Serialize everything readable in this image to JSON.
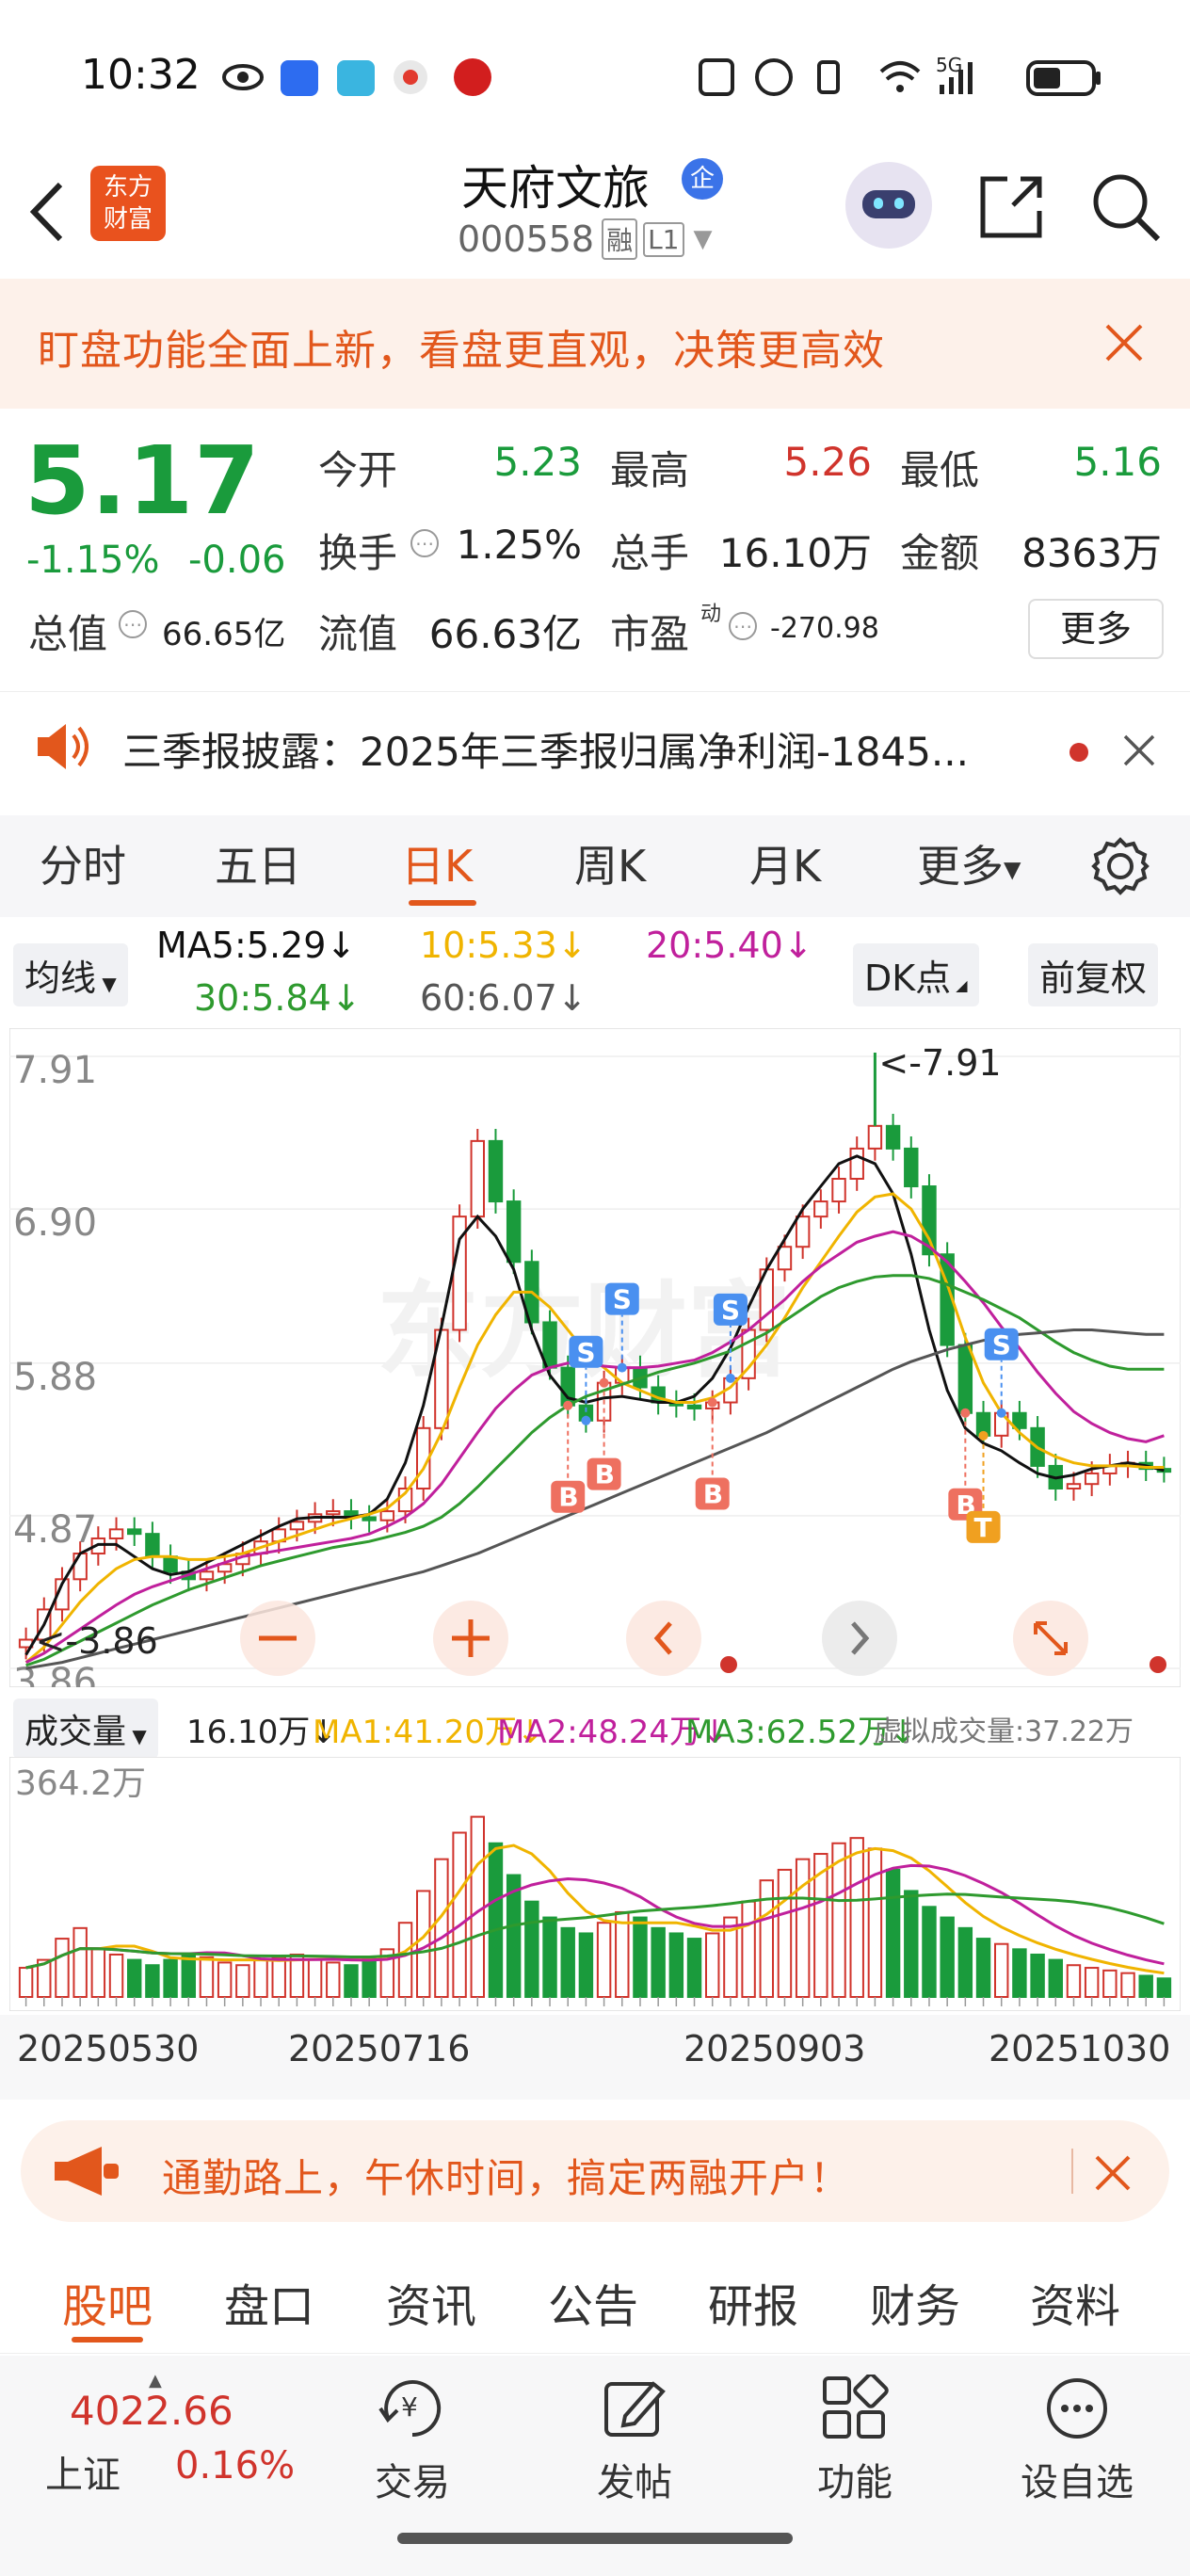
{
  "status_bar": {
    "time": "10:32",
    "network": "5G"
  },
  "header": {
    "back_label": "<",
    "logo_line1": "东方",
    "logo_line2": "财富",
    "stock_name": "天府文旅",
    "enterprise_badge": "企",
    "stock_code": "000558",
    "margin_badge": "融",
    "level_badge": "L1"
  },
  "promo": {
    "text": "盯盘功能全面上新，看盘更直观，决策更高效"
  },
  "quote": {
    "price": "5.17",
    "change_pct": "-1.15%",
    "change_abs": "-0.06",
    "open_label": "今开",
    "open": "5.23",
    "high_label": "最高",
    "high": "5.26",
    "low_label": "最低",
    "low": "5.16",
    "turnover_label": "换手",
    "turnover": "1.25%",
    "volume_label": "总手",
    "volume": "16.10万",
    "amount_label": "金额",
    "amount": "8363万",
    "mktcap_label": "总值",
    "mktcap": "66.65亿",
    "float_label": "流值",
    "float_cap": "66.63亿",
    "pe_label": "市盈",
    "pe_sup": "动",
    "pe": "-270.98",
    "more_button": "更多"
  },
  "ticker": {
    "text": "三季报披露：2025年三季报归属净利润-1845..."
  },
  "period_tabs": [
    "分时",
    "五日",
    "日K",
    "周K",
    "月K",
    "更多"
  ],
  "active_tab": "日K",
  "indicators": {
    "ma_select": "均线",
    "ma5": "MA5:5.29",
    "ma10": "10:5.33",
    "ma20": "20:5.40",
    "ma30": "30:5.84",
    "ma60": "60:6.07",
    "dk_button": "DK点",
    "adjust_button": "前复权"
  },
  "colors": {
    "up": "#d0342c",
    "down": "#1a9b3c",
    "ma5": "#111111",
    "ma10": "#f0b400",
    "ma20": "#c0209c",
    "ma30": "#2e9a2e",
    "ma60": "#555555",
    "accent": "#e2571c"
  },
  "chart_data": {
    "type": "candlestick",
    "y_ticks": [
      "7.91",
      "6.90",
      "5.88",
      "4.87",
      "3.86"
    ],
    "ylim": [
      3.86,
      7.91
    ],
    "max_label": "<-7.91",
    "min_label": "<-3.86",
    "close_series": [
      4.05,
      4.25,
      4.45,
      4.62,
      4.72,
      4.78,
      4.75,
      4.6,
      4.5,
      4.45,
      4.5,
      4.55,
      4.62,
      4.7,
      4.78,
      4.83,
      4.88,
      4.9,
      4.86,
      4.84,
      4.9,
      5.05,
      5.45,
      6.1,
      6.85,
      7.35,
      6.95,
      6.55,
      6.15,
      5.85,
      5.6,
      5.5,
      5.75,
      5.85,
      5.72,
      5.62,
      5.6,
      5.58,
      5.62,
      5.78,
      6.1,
      6.5,
      6.65,
      6.85,
      6.95,
      7.1,
      7.3,
      7.45,
      7.3,
      7.05,
      6.6,
      6.0,
      5.55,
      5.4,
      5.55,
      5.45,
      5.2,
      5.05,
      5.08,
      5.15,
      5.2,
      5.22,
      5.18,
      5.17
    ],
    "ma_series": [
      {
        "name": "MA5",
        "values": [
          3.95,
          4.15,
          4.42,
          4.62,
          4.68,
          4.68,
          4.6,
          4.52,
          4.48,
          4.5,
          4.56,
          4.62,
          4.68,
          4.74,
          4.8,
          4.85,
          4.86,
          4.86,
          4.86,
          4.88,
          4.98,
          5.22,
          5.6,
          6.12,
          6.7,
          6.85,
          6.72,
          6.5,
          6.1,
          5.8,
          5.65,
          5.62,
          5.65,
          5.66,
          5.64,
          5.62,
          5.62,
          5.66,
          5.78,
          5.98,
          6.25,
          6.5,
          6.7,
          6.9,
          7.05,
          7.2,
          7.25,
          7.2,
          7.0,
          6.6,
          6.1,
          5.7,
          5.45,
          5.35,
          5.3,
          5.22,
          5.15,
          5.12,
          5.14,
          5.18,
          5.2,
          5.22,
          5.2,
          5.17
        ]
      },
      {
        "name": "MA10",
        "values": [
          3.9,
          4.0,
          4.15,
          4.3,
          4.42,
          4.52,
          4.58,
          4.6,
          4.6,
          4.58,
          4.58,
          4.6,
          4.62,
          4.66,
          4.7,
          4.74,
          4.78,
          4.82,
          4.85,
          4.88,
          4.92,
          5.02,
          5.18,
          5.42,
          5.72,
          6.0,
          6.2,
          6.35,
          6.35,
          6.25,
          6.1,
          5.95,
          5.85,
          5.75,
          5.7,
          5.65,
          5.62,
          5.62,
          5.65,
          5.72,
          5.85,
          6.0,
          6.18,
          6.38,
          6.55,
          6.72,
          6.88,
          6.98,
          7.0,
          6.9,
          6.7,
          6.4,
          6.05,
          5.75,
          5.55,
          5.42,
          5.32,
          5.26,
          5.22,
          5.2,
          5.2,
          5.2,
          5.19,
          5.19
        ]
      },
      {
        "name": "MA20",
        "values": [
          3.9,
          3.96,
          4.04,
          4.12,
          4.2,
          4.28,
          4.35,
          4.4,
          4.44,
          4.48,
          4.52,
          4.56,
          4.6,
          4.62,
          4.64,
          4.66,
          4.68,
          4.7,
          4.72,
          4.75,
          4.8,
          4.86,
          4.95,
          5.08,
          5.25,
          5.42,
          5.58,
          5.7,
          5.8,
          5.85,
          5.88,
          5.88,
          5.86,
          5.85,
          5.85,
          5.86,
          5.88,
          5.9,
          5.95,
          6.02,
          6.1,
          6.2,
          6.3,
          6.42,
          6.52,
          6.6,
          6.68,
          6.72,
          6.75,
          6.72,
          6.65,
          6.55,
          6.42,
          6.28,
          6.12,
          5.98,
          5.82,
          5.68,
          5.56,
          5.48,
          5.42,
          5.38,
          5.36,
          5.4
        ]
      },
      {
        "name": "MA30",
        "values": [
          3.88,
          3.92,
          3.98,
          4.04,
          4.1,
          4.16,
          4.22,
          4.28,
          4.33,
          4.38,
          4.42,
          4.46,
          4.5,
          4.54,
          4.57,
          4.6,
          4.63,
          4.66,
          4.68,
          4.7,
          4.73,
          4.76,
          4.8,
          4.86,
          4.95,
          5.06,
          5.18,
          5.3,
          5.42,
          5.52,
          5.6,
          5.66,
          5.7,
          5.74,
          5.78,
          5.82,
          5.85,
          5.88,
          5.92,
          5.96,
          6.02,
          6.08,
          6.16,
          6.24,
          6.32,
          6.38,
          6.42,
          6.45,
          6.46,
          6.46,
          6.44,
          6.4,
          6.35,
          6.3,
          6.24,
          6.18,
          6.1,
          6.02,
          5.95,
          5.9,
          5.86,
          5.84,
          5.84,
          5.84
        ]
      },
      {
        "name": "MA60",
        "values": [
          3.86,
          3.88,
          3.9,
          3.93,
          3.96,
          3.99,
          4.02,
          4.05,
          4.08,
          4.11,
          4.14,
          4.17,
          4.2,
          4.23,
          4.26,
          4.29,
          4.32,
          4.35,
          4.38,
          4.41,
          4.44,
          4.47,
          4.5,
          4.54,
          4.58,
          4.62,
          4.67,
          4.72,
          4.77,
          4.82,
          4.87,
          4.92,
          4.97,
          5.02,
          5.07,
          5.12,
          5.17,
          5.22,
          5.27,
          5.32,
          5.37,
          5.42,
          5.48,
          5.54,
          5.6,
          5.66,
          5.72,
          5.78,
          5.84,
          5.89,
          5.93,
          5.97,
          6.0,
          6.03,
          6.05,
          6.07,
          6.08,
          6.09,
          6.1,
          6.1,
          6.09,
          6.08,
          6.07,
          6.07
        ]
      }
    ],
    "markers": [
      {
        "label": "B",
        "index": 30
      },
      {
        "label": "B",
        "index": 32
      },
      {
        "label": "S",
        "index": 31
      },
      {
        "label": "S",
        "index": 33
      },
      {
        "label": "B",
        "index": 38
      },
      {
        "label": "S",
        "index": 39
      },
      {
        "label": "B",
        "index": 52
      },
      {
        "label": "T",
        "index": 53
      },
      {
        "label": "S",
        "index": 54
      }
    ]
  },
  "volume": {
    "select": "成交量",
    "vol": "16.10万",
    "ma1": "MA1:41.20万",
    "ma2": "MA2:48.24万",
    "ma3": "MA3:62.52万",
    "virtual": "虚拟成交量:37.22万",
    "max_label": "364.2万",
    "ylim": [
      0,
      364.2
    ],
    "values": [
      55,
      70,
      110,
      130,
      90,
      80,
      70,
      60,
      70,
      80,
      75,
      65,
      60,
      70,
      75,
      80,
      70,
      65,
      60,
      75,
      90,
      140,
      200,
      260,
      310,
      340,
      290,
      230,
      180,
      150,
      130,
      120,
      140,
      160,
      150,
      130,
      120,
      110,
      120,
      150,
      180,
      220,
      240,
      260,
      270,
      290,
      300,
      280,
      240,
      200,
      170,
      150,
      130,
      110,
      100,
      90,
      80,
      70,
      60,
      55,
      50,
      45,
      40,
      35
    ],
    "dates": [
      "20250530",
      "20250716",
      "20250903",
      "20251030"
    ]
  },
  "promo2": {
    "text": "通勤路上，午休时间，搞定两融开户！"
  },
  "content_tabs": [
    "股吧",
    "盘口",
    "资讯",
    "公告",
    "研报",
    "财务",
    "资料"
  ],
  "bottom_bar": {
    "index_value": "4022.66",
    "index_name": "上证",
    "index_change": "0.16%",
    "trade": "交易",
    "post": "发帖",
    "features": "功能",
    "watchlist": "设自选"
  }
}
